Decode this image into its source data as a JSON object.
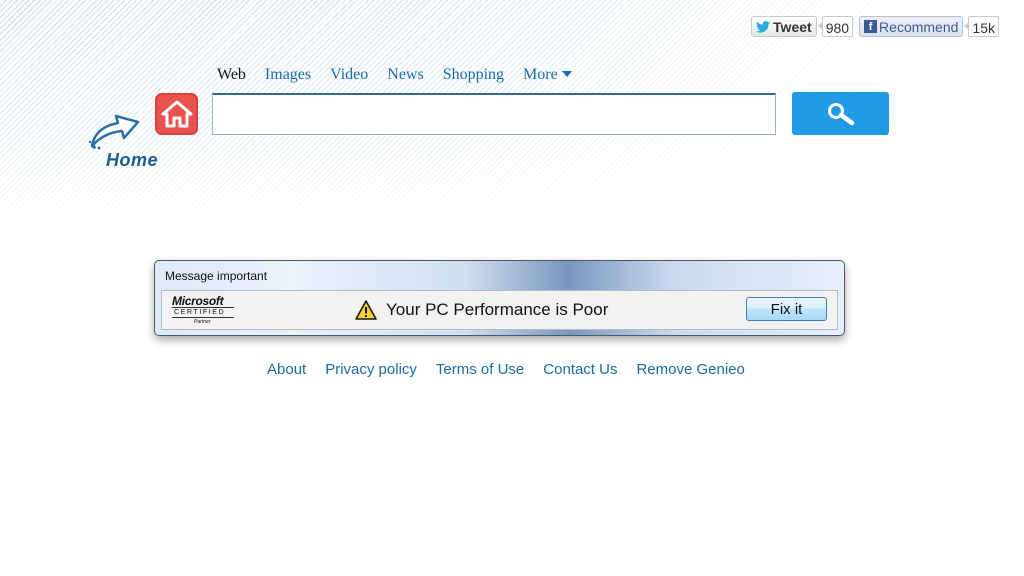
{
  "social": {
    "tweet_label": "Tweet",
    "tweet_count": "980",
    "recommend_label": "Recommend",
    "recommend_count": "15k",
    "facebook_glyph": "f"
  },
  "logo": {
    "label": "Home"
  },
  "nav": {
    "items": [
      "Web",
      "Images",
      "Video",
      "News",
      "Shopping",
      "More"
    ]
  },
  "search": {
    "value": "",
    "placeholder": ""
  },
  "dialog": {
    "title": "Message important",
    "ms_brand": "Microsoft",
    "ms_certified": "CERTIFIED",
    "ms_partner": "Partner",
    "message": "Your PC Performance is Poor",
    "button_label": "Fix it"
  },
  "footer": {
    "links": [
      "About",
      "Privacy policy",
      "Terms of Use",
      "Contact Us",
      "Remove Genieo"
    ]
  },
  "colors": {
    "accent": "#1f9be6",
    "link": "#1a6aa8",
    "home_button": "#e9534f"
  },
  "icons": {
    "twitter": "twitter-bird-icon",
    "facebook": "facebook-icon",
    "home_arrow": "arrow-icon",
    "home_button": "house-icon",
    "search": "magnifier-icon",
    "warning": "warning-triangle-icon",
    "more": "caret-down-icon"
  }
}
